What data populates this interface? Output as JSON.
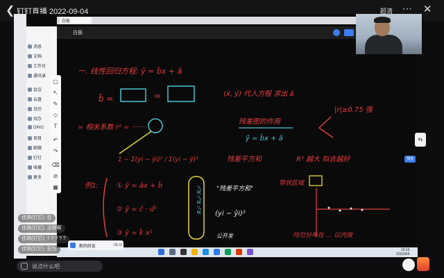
{
  "live": {
    "title": "钉钉直播 2022-09-04",
    "quality": "超清"
  },
  "screen": {
    "tab_label": "白板",
    "whiteboard_title": "白板",
    "status_pill": "00:27:45 直播中",
    "sidebar": [
      {
        "label": "消息"
      },
      {
        "label": "文档"
      },
      {
        "label": "工作台"
      },
      {
        "label": "通讯录"
      },
      {
        "label": "会议"
      },
      {
        "label": "云盘"
      },
      {
        "label": "日历"
      },
      {
        "label": "待办"
      },
      {
        "label": "DING"
      },
      {
        "label": "项目"
      },
      {
        "label": "邮箱"
      },
      {
        "label": "钉钉"
      },
      {
        "label": "收藏"
      },
      {
        "label": "更多"
      }
    ],
    "toolbar": [
      "select-icon",
      "pointer-icon",
      "pen-icon",
      "shape-icon",
      "text-icon",
      "undo-icon",
      "redo-icon",
      "eraser-icon",
      "clear-icon",
      "grid-icon"
    ],
    "side_button": "预览",
    "taskbar": {
      "notify_text": "新的好友",
      "notify_time": "08:32",
      "clock_time": "10:15",
      "clock_date": "2022/9/4"
    },
    "whiteboard_math": {
      "line1": "一. 线性回归方程:  ŷ = b̂x + â",
      "line2": "b̂ =",
      "line3": "(x̄, ȳ) 代入方程 求出 â",
      "line4": "= 相关系数 r² = ·······",
      "line5": "残差图的作用",
      "line6": "|r|≥0.75 强",
      "line7": "ŷ = b̂x + â",
      "line8": "1 − Σ(yi − ŷi)² / Σ(yi − ȳ)²",
      "line9": "残差平方和",
      "line10": "R² 越大   拟合越好",
      "line11": "例1:",
      "line12": "① ŷ = âx + b̂",
      "line13": "② ŷ = ĉ · d̂ˣ",
      "line14": "③ ŷ = k̂ x²",
      "line15": "R₁²  R₂²  R₃²",
      "line16": "\"残差平方和\"",
      "line17": "(yi − ŷi)²",
      "line18": "公开发",
      "line19": "均匀分布在 ... 以内效",
      "line20": "带状区域"
    }
  },
  "chat": [
    {
      "user": "佳琪(钉钉):",
      "text": "在"
    },
    {
      "user": "佳琪(钉钉):",
      "text": "没得啊"
    },
    {
      "user": "佳琪(钉钉):",
      "text": "? ? ? ? ?"
    },
    {
      "user": "佳琪(钉钉):",
      "text": "形为"
    }
  ],
  "chat_input_placeholder": "说点什么吧",
  "colors": {
    "accent": "#3a7be8",
    "ink_white": "#e8e8e8",
    "ink_red": "#e43d3d",
    "ink_yellow": "#e6d83a",
    "ink_cyan": "#4cc2d6"
  }
}
